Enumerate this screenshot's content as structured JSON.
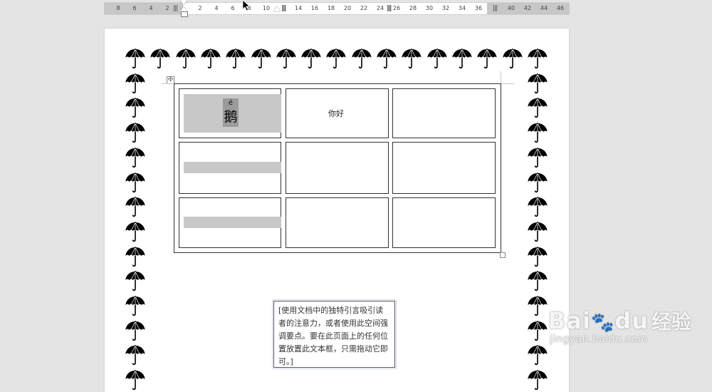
{
  "ruler": {
    "numbers": [
      "8",
      "6",
      "4",
      "2",
      "2",
      "4",
      "6",
      "8",
      "10",
      "14",
      "16",
      "18",
      "20",
      "22",
      "24",
      "26",
      "28",
      "30",
      "32",
      "34",
      "36",
      "40",
      "42",
      "44",
      "46"
    ]
  },
  "table": {
    "cell_1_pinyin": "é",
    "cell_1_char": "鹅",
    "cell_2_text": "你好"
  },
  "quote_box": {
    "text": "[使用文档中的独特引言吸引读者的注意力，或者使用此空间强调要点。要在此页面上的任何位置放置此文本框，只需拖动它即可。]"
  },
  "partial_text": "... ... ...",
  "watermark": {
    "logo": "Bai",
    "logo_suffix": "du",
    "cn": "经验",
    "url": "jingyan.baidu.com"
  },
  "colors": {
    "workspace": "#e4e4e4",
    "cell_highlight": "#c8c8c8",
    "char_highlight": "#9b9b9b"
  },
  "icons": {
    "border_art": "umbrella-icon",
    "table_move": "move-handle-icon",
    "cursor": "mouse-pointer-icon"
  }
}
